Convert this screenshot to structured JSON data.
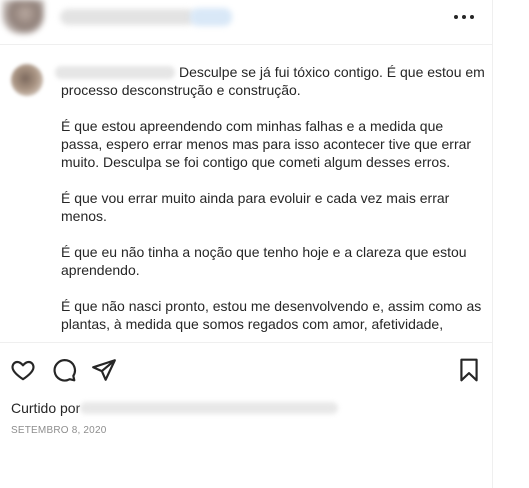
{
  "header": {
    "more_icon": "more-horizontal-icon"
  },
  "caption": {
    "paragraphs": [
      "Desculpe se já fui tóxico contigo. É que estou em processo desconstrução e construção.",
      "É que estou apreendendo com minhas falhas e a medida que passa, espero errar menos mas para isso acontecer tive que errar muito. Desculpa se foi contigo que cometi algum desses erros.",
      "É que vou errar muito ainda para evoluir e cada vez mais errar menos.",
      "É que eu não tinha a noção que tenho hoje e a clareza que estou aprendendo.",
      "É que não nasci pronto, estou me desenvolvendo e, assim como as plantas, à medida que somos regados com amor, afetividade,"
    ]
  },
  "actions": {
    "icons": [
      "heart-icon",
      "comment-icon",
      "share-icon",
      "bookmark-icon"
    ]
  },
  "likes": {
    "label": "Curtido por"
  },
  "date": "SETEMBRO 8, 2020",
  "colors": {
    "text": "#262626",
    "secondary": "#8e8e8e",
    "divider": "#efefef"
  }
}
